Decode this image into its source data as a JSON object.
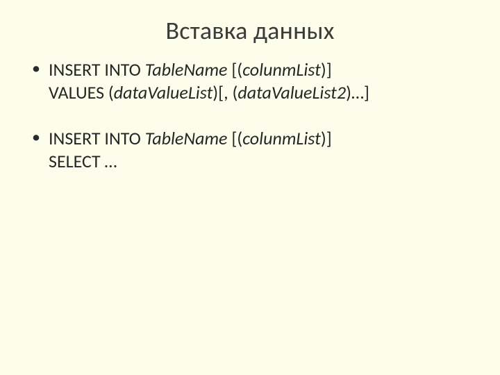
{
  "title": "Вставка данных",
  "bullets": [
    {
      "l1": {
        "pre": " INSERT INTO ",
        "i1": "TableName",
        "mid1": "  [(",
        "i2": "colunmList",
        "post": ")]"
      },
      "l2": {
        "pre": "VALUES (",
        "i1": "dataValueList",
        "mid1": ")[, (",
        "i2": "dataValueList2",
        "post": ")…]"
      }
    },
    {
      "l1": {
        "pre": "INSERT INTO ",
        "i1": "TableName",
        "mid1": "  [(",
        "i2": "colunmList",
        "post": ")]"
      },
      "l2": {
        "pre": "SELECT …",
        "i1": "",
        "mid1": "",
        "i2": "",
        "post": ""
      }
    }
  ]
}
